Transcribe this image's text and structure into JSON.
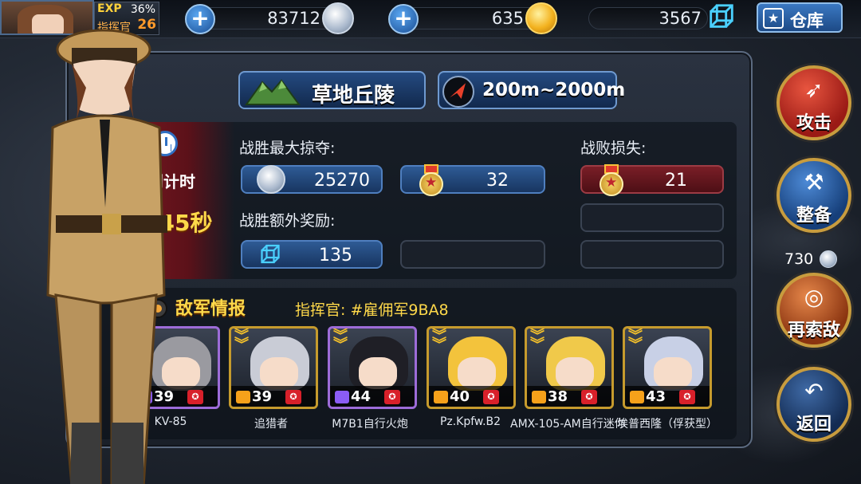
{
  "colors": {
    "gold": "#ffd94a",
    "accent_blue": "#2e5b95",
    "danger_red": "#8a1d26",
    "card_gold": "#c69b2d",
    "card_purple": "#9d6cd8"
  },
  "player": {
    "exp_label": "EXP",
    "exp_percent": "36%",
    "rank": "指挥官",
    "level": "26"
  },
  "resources": [
    {
      "value": "83712",
      "icon": "silver-coin-icon"
    },
    {
      "value": "635",
      "icon": "gold-coin-icon"
    },
    {
      "value": "3567",
      "icon": "cube-icon"
    }
  ],
  "warehouse_button": {
    "label": "仓库"
  },
  "battle": {
    "terrain": "草地丘陵",
    "range": "200m~2000m",
    "countdown_label": "开战倒计时",
    "countdown_value": "2分45秒",
    "max_loot_label": "战胜最大掠夺:",
    "loss_label": "战败损失:",
    "extra_reward_label": "战胜额外奖励:",
    "loot_silver": "25270",
    "loot_medal": "32",
    "loss_medal": "21",
    "extra_cube": "135"
  },
  "enemy": {
    "title": "敌军情报",
    "commander": "指挥官: #雇佣军9BA8",
    "units": [
      {
        "name": "KV-85",
        "level": "39",
        "rarity": "purple",
        "hair": "#9a9aa0"
      },
      {
        "name": "追猎者",
        "level": "39",
        "rarity": "gold",
        "hair": "#c9ccd6"
      },
      {
        "name": "M7B1自行火炮",
        "level": "44",
        "rarity": "purple",
        "hair": "#1f1f26"
      },
      {
        "name": "Pz.Kpfw.B2",
        "level": "40",
        "rarity": "gold",
        "hair": "#f3c33c"
      },
      {
        "name": "AMX-105-AM自行迷你",
        "level": "38",
        "rarity": "gold",
        "hair": "#f0c94a"
      },
      {
        "name": "埃普西隆（俘获型）",
        "level": "43",
        "rarity": "gold",
        "hair": "#c8d0e6"
      }
    ]
  },
  "side_buttons": {
    "attack": "攻击",
    "prepare": "整备",
    "research_cost": "730",
    "research": "再索敌",
    "back": "返回"
  }
}
